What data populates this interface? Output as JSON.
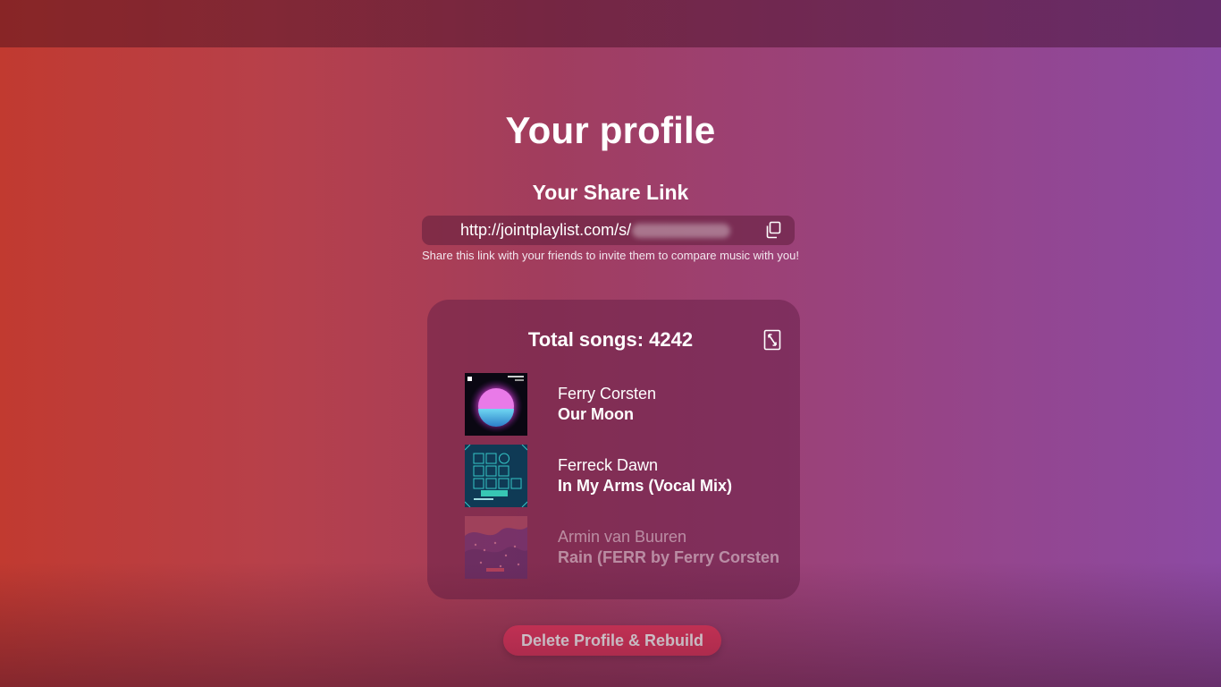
{
  "page": {
    "title": "Your profile"
  },
  "share": {
    "heading": "Your Share Link",
    "url_prefix": "http://jointplaylist.com/s/",
    "hint": "Share this link with your friends to invite them to compare music with you!"
  },
  "songs": {
    "total_label": "Total songs: 4242",
    "items": [
      {
        "artist": "Ferry Corsten",
        "title": "Our Moon"
      },
      {
        "artist": "Ferreck Dawn",
        "title": "In My Arms (Vocal Mix)"
      },
      {
        "artist": "Armin van Buuren",
        "title": "Rain (FERR by Ferry Corsten Remix)"
      }
    ]
  },
  "actions": {
    "delete_label": "Delete Profile & Rebuild"
  },
  "icons": {
    "copy": "copy-icon",
    "expand": "expand-icon"
  },
  "colors": {
    "delete_button": "#e73a60",
    "background_left": "#c13a30",
    "background_right": "#8c4aa4"
  }
}
